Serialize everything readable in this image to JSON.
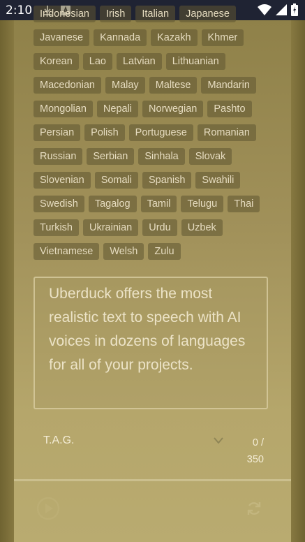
{
  "status_bar": {
    "time": "2:10"
  },
  "languages": [
    [
      "Indonesian",
      "Irish",
      "Italian",
      "Japanese"
    ],
    [
      "Javanese",
      "Kannada",
      "Kazakh",
      "Khmer"
    ],
    [
      "Korean",
      "Lao",
      "Latvian",
      "Lithuanian"
    ],
    [
      "Macedonian",
      "Malay",
      "Maltese",
      "Mandarin"
    ],
    [
      "Mongolian",
      "Nepali",
      "Norwegian",
      "Pashto"
    ],
    [
      "Persian",
      "Polish",
      "Portuguese",
      "Romanian"
    ],
    [
      "Russian",
      "Serbian",
      "Sinhala",
      "Slovak"
    ],
    [
      "Slovenian",
      "Somali",
      "Spanish",
      "Swahili"
    ],
    [
      "Swedish",
      "Tagalog",
      "Tamil",
      "Telugu",
      "Thai"
    ],
    [
      "Turkish",
      "Ukrainian",
      "Urdu",
      "Uzbek"
    ],
    [
      "Vietnamese",
      "Welsh",
      "Zulu"
    ]
  ],
  "editor": {
    "placeholder": "Uberduck offers the most realistic text to speech with AI voices in dozens of languages for all of your projects."
  },
  "voice": {
    "name": "T.A.G.",
    "char_count": "0 / 350"
  },
  "colors": {
    "status_bar": "#1f2333",
    "chip_bg": "#5f5632",
    "accent_gold": "#a6955a"
  },
  "icons": {
    "play": "play-icon",
    "refresh": "refresh-icon",
    "dropdown": "chevron-down-icon"
  }
}
